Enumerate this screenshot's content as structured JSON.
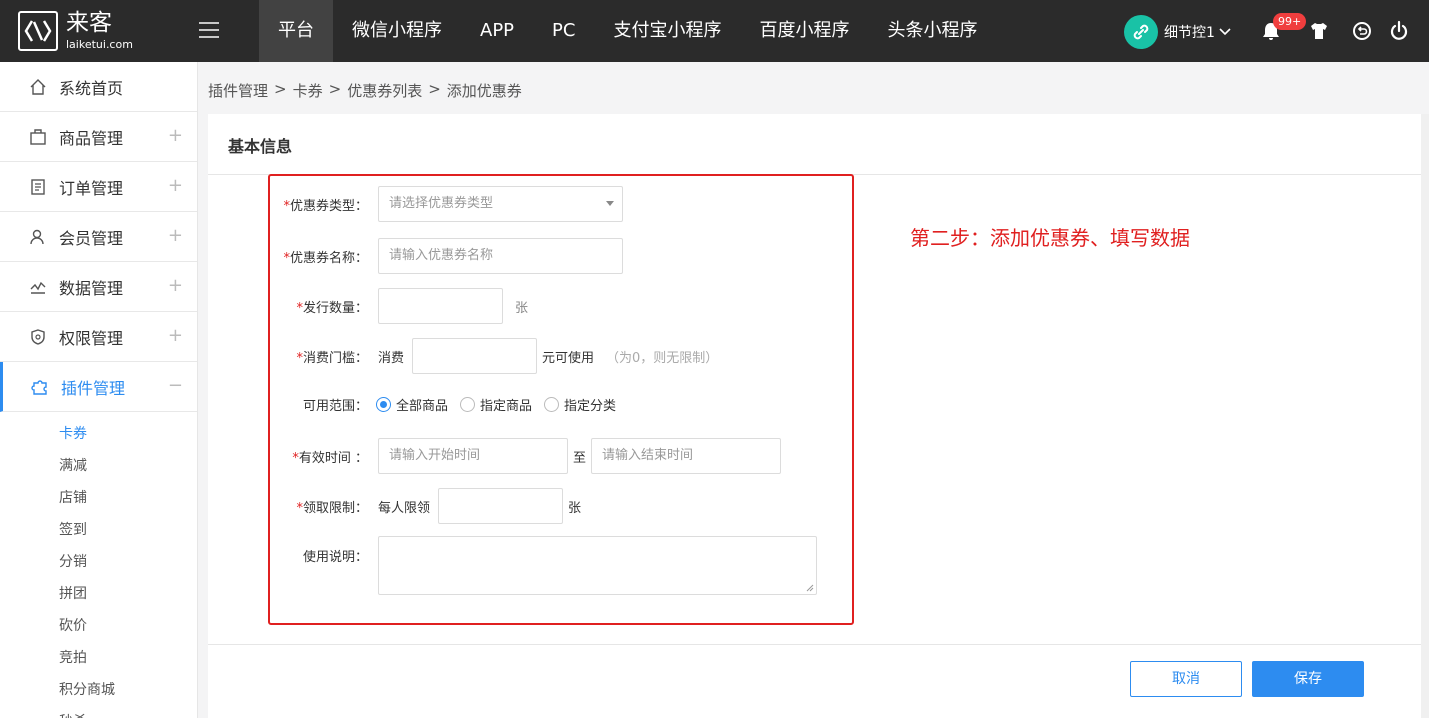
{
  "brand": {
    "name": "来客",
    "url": "laiketui.com"
  },
  "topnav": [
    "平台",
    "微信小程序",
    "APP",
    "PC",
    "支付宝小程序",
    "百度小程序",
    "头条小程序"
  ],
  "user": {
    "name": "细节控1",
    "badge": "99+"
  },
  "sidebar": {
    "items": [
      {
        "label": "系统首页",
        "icon": "home-icon",
        "expand": ""
      },
      {
        "label": "商品管理",
        "icon": "box-icon",
        "expand": "+"
      },
      {
        "label": "订单管理",
        "icon": "order-icon",
        "expand": "+"
      },
      {
        "label": "会员管理",
        "icon": "member-icon",
        "expand": "+"
      },
      {
        "label": "数据管理",
        "icon": "chart-icon",
        "expand": "+"
      },
      {
        "label": "权限管理",
        "icon": "shield-icon",
        "expand": "+"
      },
      {
        "label": "插件管理",
        "icon": "puzzle-icon",
        "expand": "−"
      }
    ],
    "subitems": [
      "卡券",
      "满减",
      "店铺",
      "签到",
      "分销",
      "拼团",
      "砍价",
      "竞拍",
      "积分商城",
      "秒杀"
    ]
  },
  "breadcrumb": [
    "插件管理",
    "卡券",
    "优惠券列表",
    "添加优惠券"
  ],
  "breadcrumb_sep": ">",
  "panel": {
    "title": "基本信息"
  },
  "annotation": "第二步：添加优惠券、填写数据",
  "form": {
    "type_label": "优惠券类型：",
    "type_placeholder": "请选择优惠券类型",
    "name_label": "优惠券名称：",
    "name_placeholder": "请输入优惠券名称",
    "qty_label": "发行数量：",
    "qty_unit": "张",
    "threshold_label": "消费门槛：",
    "threshold_prefix": "消费",
    "threshold_suffix": "元可使用",
    "threshold_hint": "（为0，则无限制）",
    "scope_label": "可用范围：",
    "scope_options": [
      "全部商品",
      "指定商品",
      "指定分类"
    ],
    "scope_selected": "全部商品",
    "time_label": "有效时间 ：",
    "time_start_placeholder": "请输入开始时间",
    "time_to": "至",
    "time_end_placeholder": "请输入结束时间",
    "limit_label": "领取限制：",
    "limit_prefix": "每人限领",
    "limit_unit": "张",
    "desc_label": "使用说明："
  },
  "buttons": {
    "cancel": "取消",
    "save": "保存"
  },
  "colors": {
    "topbar": "#2b2b2b",
    "accent": "#2d8cf0",
    "highlight": "#e02020",
    "avatar": "#19c2a6",
    "badge": "#f03e3e"
  }
}
